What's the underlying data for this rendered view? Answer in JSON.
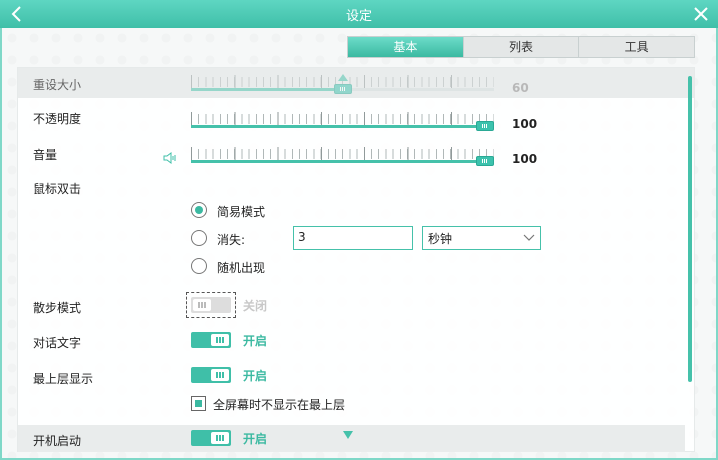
{
  "window": {
    "title": "设定"
  },
  "tabs": [
    {
      "label": "基本",
      "active": true
    },
    {
      "label": "列表",
      "active": false
    },
    {
      "label": "工具",
      "active": false
    }
  ],
  "sliders": {
    "resize": {
      "label": "重设大小",
      "value": "60",
      "level": 0.5
    },
    "opacity": {
      "label": "不透明度",
      "value": "100",
      "level": 1.0
    },
    "volume": {
      "label": "音量",
      "value": "100",
      "level": 1.0
    }
  },
  "double_click": {
    "label": "鼠标双击",
    "options": [
      "简易模式",
      "消失:",
      "随机出现"
    ],
    "selected_index": 0,
    "disappear_value": "3",
    "unit_selected": "秒钟"
  },
  "toggles": {
    "walk": {
      "label": "散步模式",
      "state": "关闭",
      "on": false
    },
    "dialog": {
      "label": "对话文字",
      "state": "开启",
      "on": true
    },
    "topmost": {
      "label": "最上层显示",
      "state": "开启",
      "on": true
    },
    "autostart": {
      "label": "开机启动",
      "state": "开启",
      "on": true
    }
  },
  "fullscreen_checkbox": {
    "label": "全屏幕时不显示在最上层",
    "checked": true
  },
  "colors": {
    "accent": "#3fbfa8",
    "titlebar": "#4fcab4"
  }
}
